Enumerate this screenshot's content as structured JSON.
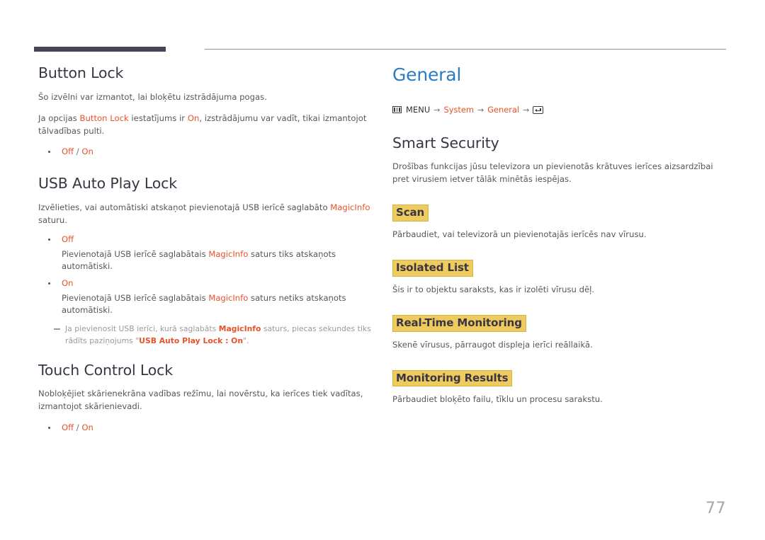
{
  "page": {
    "number": "77",
    "accent_color": "#e7522b",
    "chapter_color": "#2c7cc1",
    "heading_color": "#3c3443",
    "highlight_color": "#edcb5e",
    "rule_color": "#4a4458"
  },
  "left_column": {
    "sections": [
      {
        "title": "Button Lock",
        "paragraphs": [
          {
            "runs": [
              {
                "text": "Šo izvēlni var izmantot, lai bloķētu izstrādājuma pogas.",
                "style": "normal"
              }
            ]
          },
          {
            "runs": [
              {
                "text": "Ja opcijas ",
                "style": "normal"
              },
              {
                "text": "Button Lock",
                "style": "accent"
              },
              {
                "text": " iestatījums ir ",
                "style": "normal"
              },
              {
                "text": "On",
                "style": "accent"
              },
              {
                "text": ", izstrādājumu var vadīt, tikai izmantojot tālvadības pulti.",
                "style": "normal"
              }
            ]
          }
        ],
        "bullets": [
          {
            "runs": [
              {
                "text": "Off",
                "style": "accent"
              },
              {
                "text": " / ",
                "style": "sep"
              },
              {
                "text": "On",
                "style": "accent"
              }
            ]
          }
        ]
      },
      {
        "title": "USB Auto Play Lock",
        "paragraphs": [
          {
            "runs": [
              {
                "text": "Izvēlieties, vai automātiski atskaņot pievienotajā USB ierīcē saglabāto ",
                "style": "normal"
              },
              {
                "text": "MagicInfo",
                "style": "accent"
              },
              {
                "text": " saturu.",
                "style": "normal"
              }
            ]
          }
        ],
        "bullets": [
          {
            "label": "Off",
            "desc_runs": [
              {
                "text": "Pievienotajā USB ierīcē saglabātais ",
                "style": "normal"
              },
              {
                "text": "MagicInfo",
                "style": "accent"
              },
              {
                "text": " saturs tiks atskaņots automātiski.",
                "style": "normal"
              }
            ]
          },
          {
            "label": "On",
            "desc_runs": [
              {
                "text": "Pievienotajā USB ierīcē saglabātais ",
                "style": "normal"
              },
              {
                "text": "MagicInfo",
                "style": "accent"
              },
              {
                "text": " saturs netiks atskaņots automātiski.",
                "style": "normal"
              }
            ]
          }
        ],
        "note": {
          "runs": [
            {
              "text": "Ja pievienosit USB ierīci, kurā saglabāts ",
              "style": "lite"
            },
            {
              "text": "MagicInfo",
              "style": "accent-b"
            },
            {
              "text": " saturs, piecas sekundes tiks rādīts paziņojums \"",
              "style": "lite"
            },
            {
              "text": "USB Auto Play Lock : On",
              "style": "accent-b"
            },
            {
              "text": "\".",
              "style": "lite"
            }
          ]
        }
      },
      {
        "title": "Touch Control Lock",
        "paragraphs": [
          {
            "runs": [
              {
                "text": "Nobloķējiet skārienekrāna vadības režīmu, lai novērstu, ka ierīces tiek vadītas, izmantojot skārienievadi.",
                "style": "normal"
              }
            ]
          }
        ],
        "bullets": [
          {
            "runs": [
              {
                "text": "Off",
                "style": "accent"
              },
              {
                "text": " / ",
                "style": "sep"
              },
              {
                "text": "On",
                "style": "accent"
              }
            ]
          }
        ]
      }
    ]
  },
  "right_column": {
    "chapter_title": "General",
    "menu_path": {
      "menu_icon": "menu-icon",
      "menu_label": "MENU",
      "arrow": "→",
      "items": [
        "System",
        "General"
      ],
      "enter_icon": "enter-key-icon"
    },
    "sections": [
      {
        "title": "Smart Security",
        "paragraphs": [
          {
            "runs": [
              {
                "text": "Drošības funkcijas jūsu televizora un pievienotās krātuves ierīces aizsardzībai pret virusiem ietver tālāk minētās iespējas.",
                "style": "normal"
              }
            ]
          }
        ],
        "subsections": [
          {
            "title": "Scan",
            "paragraph": "Pārbaudiet, vai televizorā un pievienotajās ierīcēs nav vīrusu."
          },
          {
            "title": "Isolated List",
            "paragraph": "Šis ir to objektu saraksts, kas ir izolēti vīrusu dēļ."
          },
          {
            "title": "Real-Time Monitoring",
            "paragraph": "Skenē vīrusus, pārraugot displeja ierīci reāllaikā."
          },
          {
            "title": "Monitoring Results",
            "paragraph": "Pārbaudiet bloķēto failu, tīklu un procesu sarakstu."
          }
        ]
      }
    ]
  }
}
